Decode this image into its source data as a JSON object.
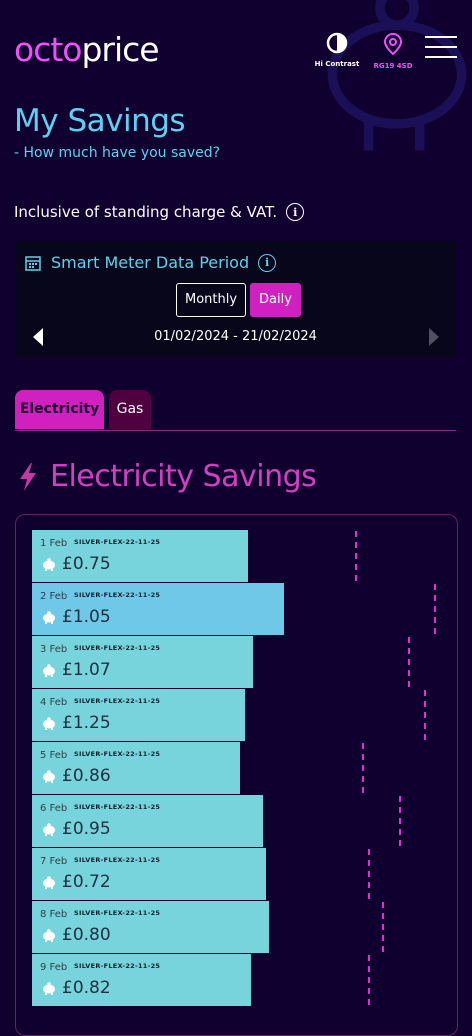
{
  "header": {
    "logo_prefix": "oct",
    "logo_o": "o",
    "logo_suffix": "price",
    "contrast_label": "Hi Contrast",
    "postcode_label": "RG19 4SD"
  },
  "page": {
    "title": "My Savings",
    "subtitle": "- How much have you saved?",
    "inclusive_note": "Inclusive of standing charge & VAT."
  },
  "period_panel": {
    "heading": "Smart Meter Data Period",
    "monthly_label": "Monthly",
    "daily_label": "Daily",
    "date_range": "01/02/2024 - 21/02/2024"
  },
  "tabs": {
    "electricity": "Electricity",
    "gas": "Gas"
  },
  "section": {
    "title": "Electricity Savings"
  },
  "savings": [
    {
      "date": "1 Feb",
      "tariff": "SILVER-FLEX-22-11-25",
      "amount": "£0.75"
    },
    {
      "date": "2 Feb",
      "tariff": "SILVER-FLEX-22-11-25",
      "amount": "£1.05"
    },
    {
      "date": "3 Feb",
      "tariff": "SILVER-FLEX-22-11-25",
      "amount": "£1.07"
    },
    {
      "date": "4 Feb",
      "tariff": "SILVER-FLEX-22-11-25",
      "amount": "£1.25"
    },
    {
      "date": "5 Feb",
      "tariff": "SILVER-FLEX-22-11-25",
      "amount": "£0.86"
    },
    {
      "date": "6 Feb",
      "tariff": "SILVER-FLEX-22-11-25",
      "amount": "£0.95"
    },
    {
      "date": "7 Feb",
      "tariff": "SILVER-FLEX-22-11-25",
      "amount": "£0.72"
    },
    {
      "date": "8 Feb",
      "tariff": "SILVER-FLEX-22-11-25",
      "amount": "£0.80"
    },
    {
      "date": "9 Feb",
      "tariff": "SILVER-FLEX-22-11-25",
      "amount": "£0.82"
    }
  ],
  "colors": {
    "background": "#100030",
    "accent_pink": "#d020c0",
    "accent_cyan": "#60d0f0",
    "row_fill": "#78d4dc"
  },
  "icons": [
    "contrast-icon",
    "location-pin-icon",
    "menu-icon",
    "calendar-icon",
    "info-icon",
    "chevron-left-icon",
    "chevron-right-icon",
    "lightning-icon",
    "piggy-bank-icon"
  ]
}
